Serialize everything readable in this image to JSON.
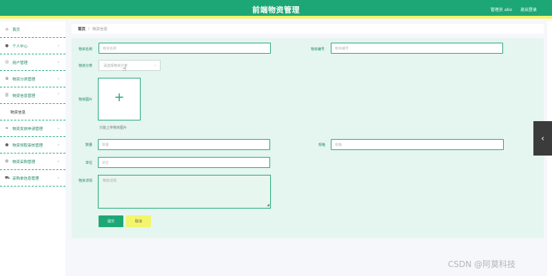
{
  "header": {
    "title": "前端物资管理",
    "user": "管理员 abo",
    "logout": "退出登录"
  },
  "sidebar": {
    "items": [
      {
        "label": "首页",
        "icon": "home-icon"
      },
      {
        "label": "个人中心",
        "icon": "user-icon"
      },
      {
        "label": "用户管理",
        "icon": "power-icon"
      },
      {
        "label": "物资分类管理",
        "icon": "list-icon"
      },
      {
        "label": "物资信息管理",
        "icon": "menu-icon"
      },
      {
        "label": "物资发放申请管理",
        "icon": "crop-icon"
      },
      {
        "label": "物资领取审核管理",
        "icon": "user-icon"
      },
      {
        "label": "物资采购管理",
        "icon": "gear-icon"
      },
      {
        "label": "采购单信息管理",
        "icon": "cart-icon"
      }
    ],
    "submenu": "物资信息"
  },
  "breadcrumb": {
    "home": "首页",
    "current": "物资信息"
  },
  "form": {
    "name_label": "物资名称",
    "name_placeholder": "物资名称",
    "code_label": "物资编号",
    "code_placeholder": "物资编号",
    "category_label": "物资分类",
    "category_placeholder": "请选择物资分类",
    "image_label": "物资图片",
    "image_hint": "只能上传物资图片",
    "qty_label": "数量",
    "qty_placeholder": "数量",
    "spec_label": "规格",
    "spec_placeholder": "规格",
    "unit_label": "单位",
    "unit_placeholder": "单位",
    "detail_label": "物资详情",
    "detail_placeholder": "物资详情",
    "submit": "提交",
    "cancel": "取消"
  },
  "watermark": "CSDN @阿莫科技",
  "colors": {
    "accent": "#1ea776",
    "highlight": "#f3f56a",
    "panel": "#e5f5ef"
  }
}
